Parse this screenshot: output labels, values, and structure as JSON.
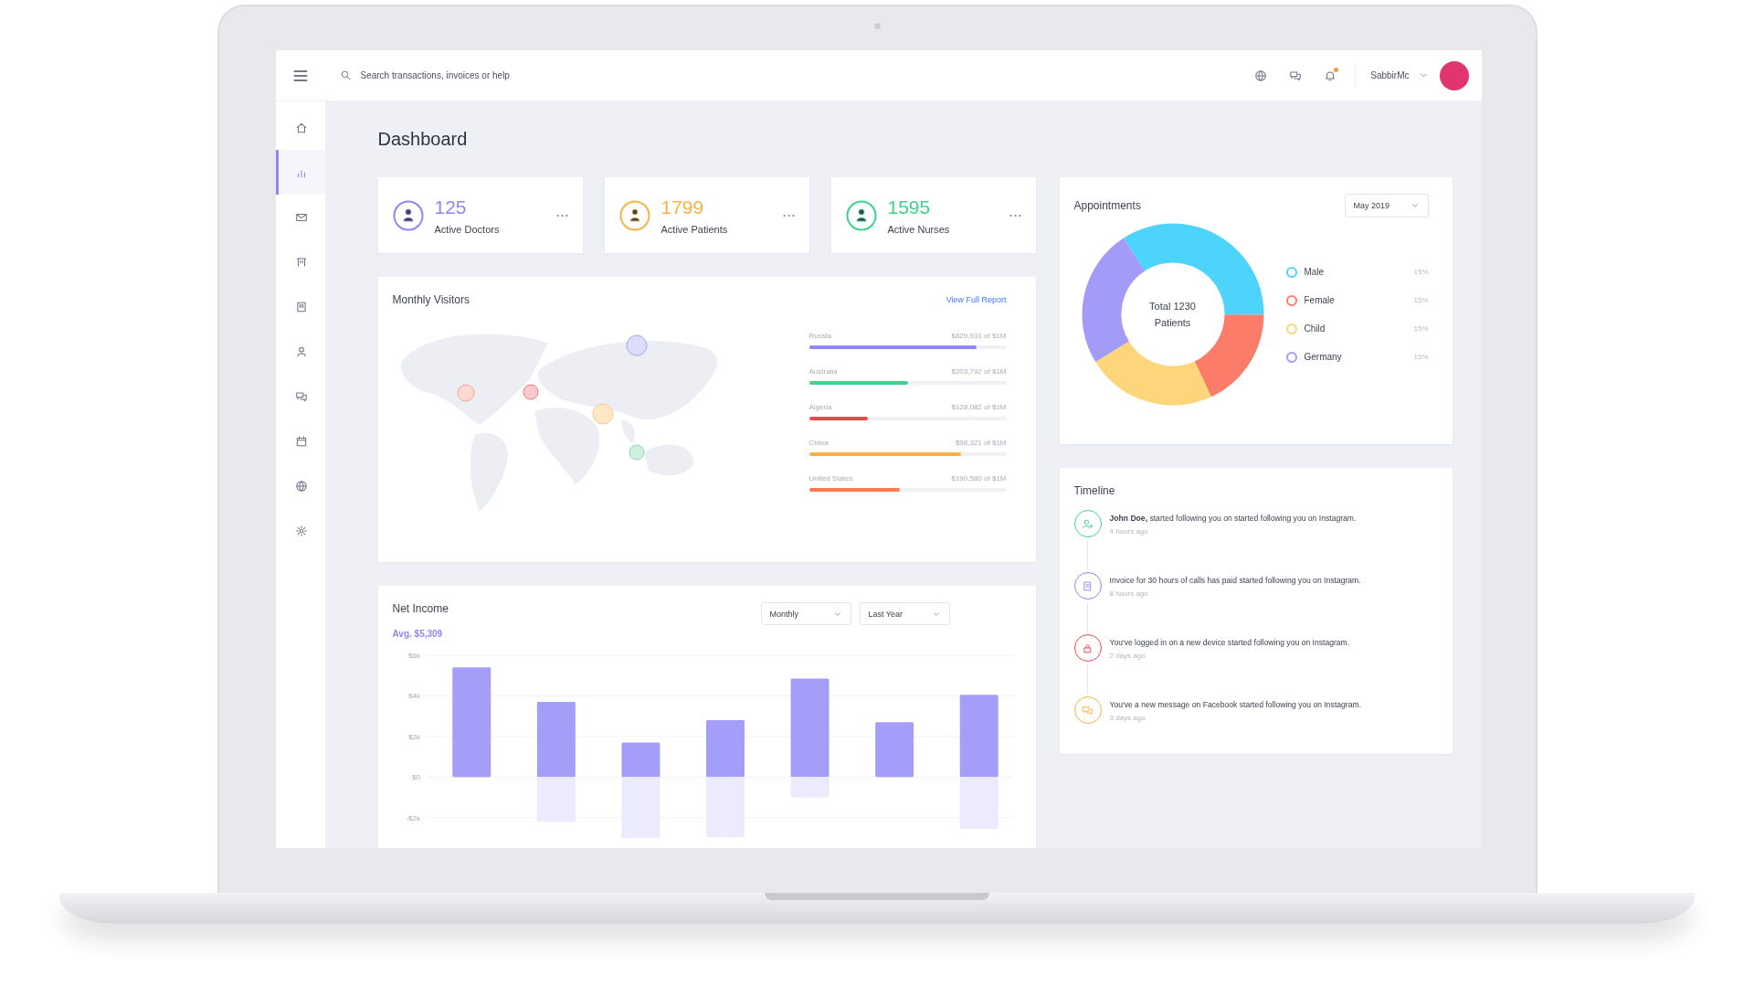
{
  "header": {
    "search": {
      "placeholder": "Search transactions, invoices or help"
    },
    "icons": [
      {
        "kind": "globe"
      },
      {
        "kind": "chat"
      },
      {
        "kind": "bell",
        "badge": true
      }
    ],
    "user": {
      "name": "SabbirMc"
    }
  },
  "sidebar": {
    "items": [
      {
        "kind": "home",
        "selected": false
      },
      {
        "kind": "chart",
        "selected": true
      },
      {
        "kind": "mail",
        "selected": false
      },
      {
        "kind": "columns",
        "selected": false
      },
      {
        "kind": "book",
        "selected": false
      },
      {
        "kind": "user",
        "selected": false
      },
      {
        "kind": "chat",
        "selected": false
      },
      {
        "kind": "calendar",
        "selected": false
      },
      {
        "kind": "globe",
        "selected": false
      },
      {
        "kind": "gear",
        "selected": false
      }
    ]
  },
  "page_title": "Dashboard",
  "stats": [
    {
      "value": "125",
      "label": "Active Doctors",
      "color": "#8f86f5"
    },
    {
      "value": "1799",
      "label": "Active Patients",
      "color": "#fbb245"
    },
    {
      "value": "1595",
      "label": "Active Nurses",
      "color": "#3ed38a"
    }
  ],
  "monthly_visitors": {
    "title": "Monthly Visitors",
    "link": "View Full Report",
    "countries": [
      {
        "name": "Russia",
        "amount": "$829,910 of $1M",
        "level": 0.85,
        "color": "#8f86f5"
      },
      {
        "name": "Australia",
        "amount": "$203,792 of $1M",
        "level": 0.5,
        "color": "#3ed38a"
      },
      {
        "name": "Algeria",
        "amount": "$128,082 of $1M",
        "level": 0.3,
        "color": "#f5454f"
      },
      {
        "name": "China",
        "amount": "$98,321 of $1M",
        "level": 0.77,
        "color": "#fbb245"
      },
      {
        "name": "United States",
        "amount": "$190,580 of $1M",
        "level": 0.46,
        "color": "#fb7b4b"
      }
    ]
  },
  "net_income": {
    "title": "Net Income",
    "average": "Avg. $5,309",
    "filters": [
      "Monthly",
      "Last Year"
    ],
    "chart_data": {
      "type": "bar",
      "grid": true,
      "ylim": [
        -3,
        6
      ],
      "yticks": [
        {
          "value": 6,
          "label": "$6k"
        },
        {
          "value": 4,
          "label": "$4k"
        },
        {
          "value": 2,
          "label": "$2k"
        },
        {
          "value": 0,
          "label": "$0"
        },
        {
          "value": -2,
          "label": "-$2k"
        }
      ],
      "stacked": true,
      "series": [
        {
          "color": "#a49ef9",
          "values": [
            5.4,
            3.7,
            1.7,
            2.8,
            4.85,
            2.7,
            4.05
          ]
        },
        {
          "color": "#ecebfd",
          "values": [
            null,
            -2.2,
            -3,
            -2.95,
            -1.0,
            null,
            -2.55
          ]
        }
      ]
    }
  },
  "appointments": {
    "title": "Appointments",
    "filter": "May 2019",
    "center_label": "Total 1230 Patients",
    "legend": [
      {
        "label": "Male",
        "value": "15%",
        "color": "#4dd4fb"
      },
      {
        "label": "Female",
        "value": "15%",
        "color": "#fb7d69"
      },
      {
        "label": "Child",
        "value": "15%",
        "color": "#fdd57a"
      },
      {
        "label": "Germany",
        "value": "15%",
        "color": "#a29bf7"
      }
    ]
  },
  "timeline": {
    "title": "Timeline",
    "events": [
      {
        "kind": "user-plus",
        "color": "#3ed38a",
        "text": "**John Doe,** started following you on started following you on Instagram.",
        "time": "4 hours ago"
      },
      {
        "kind": "invoice",
        "color": "#8f86f5",
        "text": "Invoice for 30 hours of calls has paid started following you on Instagram.",
        "time": "8 hours ago"
      },
      {
        "kind": "lock",
        "color": "#f5454f",
        "text": "You've logged in on a new device started following you on Instagram.",
        "time": "2 days ago"
      },
      {
        "kind": "chat",
        "color": "#fbb245",
        "text": "You've a new message on Facebook started following you on Instagram.",
        "time": "3 days ago"
      }
    ]
  }
}
